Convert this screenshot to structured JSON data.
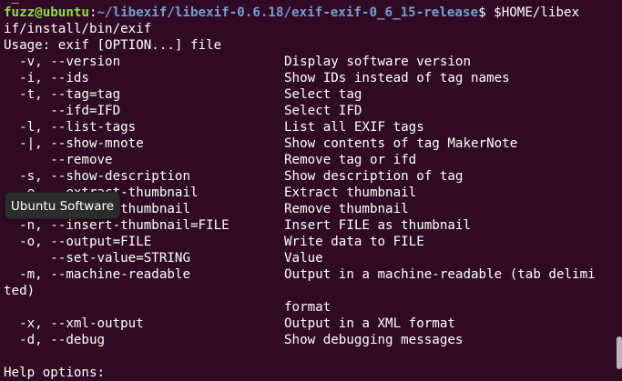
{
  "terminal": {
    "top_partial": "e_15-release",
    "prompt": {
      "user_host": "fuzz@ubuntu",
      "separator": ":",
      "path": "~/libexif/libexif-0.6.18/exif-exif-0_6_15-release",
      "symbol": "$",
      "command_part1": " $HOME/libex",
      "command_part2": "if/install/bin/exif"
    },
    "usage": "Usage: exif [OPTION...] file",
    "options": [
      {
        "flag": "  -v, --version",
        "desc": "Display software version"
      },
      {
        "flag": "  -i, --ids",
        "desc": "Show IDs instead of tag names"
      },
      {
        "flag": "  -t, --tag=tag",
        "desc": "Select tag"
      },
      {
        "flag": "      --ifd=IFD",
        "desc": "Select IFD"
      },
      {
        "flag": "  -l, --list-tags",
        "desc": "List all EXIF tags"
      },
      {
        "flag": "  -|, --show-mnote",
        "desc": "Show contents of tag MakerNote"
      },
      {
        "flag": "      --remove",
        "desc": "Remove tag or ifd"
      },
      {
        "flag": "  -s, --show-description",
        "desc": "Show description of tag"
      },
      {
        "flag": "  -e, --extract-thumbnail",
        "desc": "Extract thumbnail"
      },
      {
        "flag": "  -r, --remove-thumbnail",
        "desc": "Remove thumbnail"
      },
      {
        "flag": "  -n, --insert-thumbnail=FILE",
        "desc": "Insert FILE as thumbnail"
      },
      {
        "flag": "  -o, --output=FILE",
        "desc": "Write data to FILE"
      },
      {
        "flag": "      --set-value=STRING",
        "desc": "Value"
      },
      {
        "flag": "  -m, --machine-readable",
        "desc": "Output in a machine-readable (tab delimi"
      }
    ],
    "wrap_continuation": "ted)",
    "format_word": "format",
    "options2": [
      {
        "flag": "  -x, --xml-output",
        "desc": "Output in a XML format"
      },
      {
        "flag": "  -d, --debug",
        "desc": "Show debugging messages"
      }
    ],
    "help_header": "Help options:"
  },
  "tooltip": {
    "label": "Ubuntu Software"
  },
  "colors": {
    "background": "#300a24",
    "text": "#ffffff",
    "prompt_user": "#8ae234",
    "prompt_path": "#729fcf"
  }
}
